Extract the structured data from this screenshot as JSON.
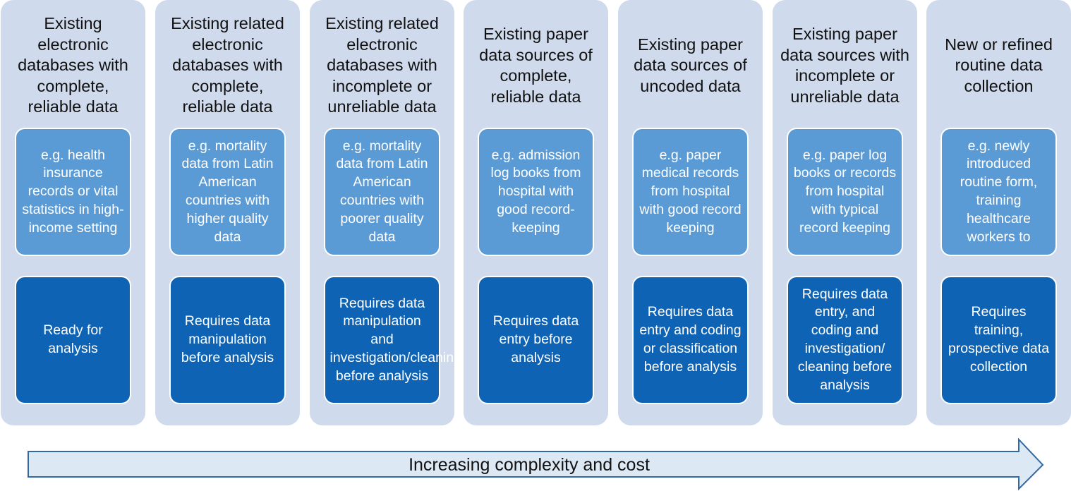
{
  "columns": [
    {
      "title": "Existing electronic databases with complete, reliable data",
      "example": "e.g. health insurance records or vital statistics in high-income setting",
      "requirement": "Ready for analysis"
    },
    {
      "title": "Existing related electronic databases with complete, reliable data",
      "example": "e.g. mortality data from Latin American countries with higher quality data",
      "requirement": "Requires data manipulation before analysis"
    },
    {
      "title": "Existing related electronic databases with incomplete or unreliable data",
      "example": "e.g. mortality data from Latin American countries with poorer quality data",
      "requirement": "Requires data manipulation and investigation/cleaning before analysis"
    },
    {
      "title": "Existing paper data sources of complete, reliable data",
      "example": "e.g. admission log books from hospital with good record-keeping",
      "requirement": "Requires data entry before analysis"
    },
    {
      "title": "Existing paper data sources of uncoded data",
      "example": "e.g. paper medical records from hospital with good record keeping",
      "requirement": "Requires data entry and coding or classification before analysis"
    },
    {
      "title": "Existing paper data sources with incomplete or unreliable data",
      "example": "e.g. paper log books or records from hospital with typical record keeping",
      "requirement": "Requires data entry, and coding and investigation/ cleaning before analysis"
    },
    {
      "title": "New or refined routine data collection",
      "example": "e.g. newly introduced routine form, training healthcare workers to",
      "requirement": "Requires training, prospective data collection"
    }
  ],
  "arrow": {
    "label": "Increasing complexity and cost"
  },
  "colors": {
    "column_bg": "#cfdaec",
    "example_box": "#5b9bd5",
    "requirement_box": "#0e63b5",
    "arrow_fill": "#dde8f5",
    "arrow_stroke": "#2f6aa6"
  }
}
